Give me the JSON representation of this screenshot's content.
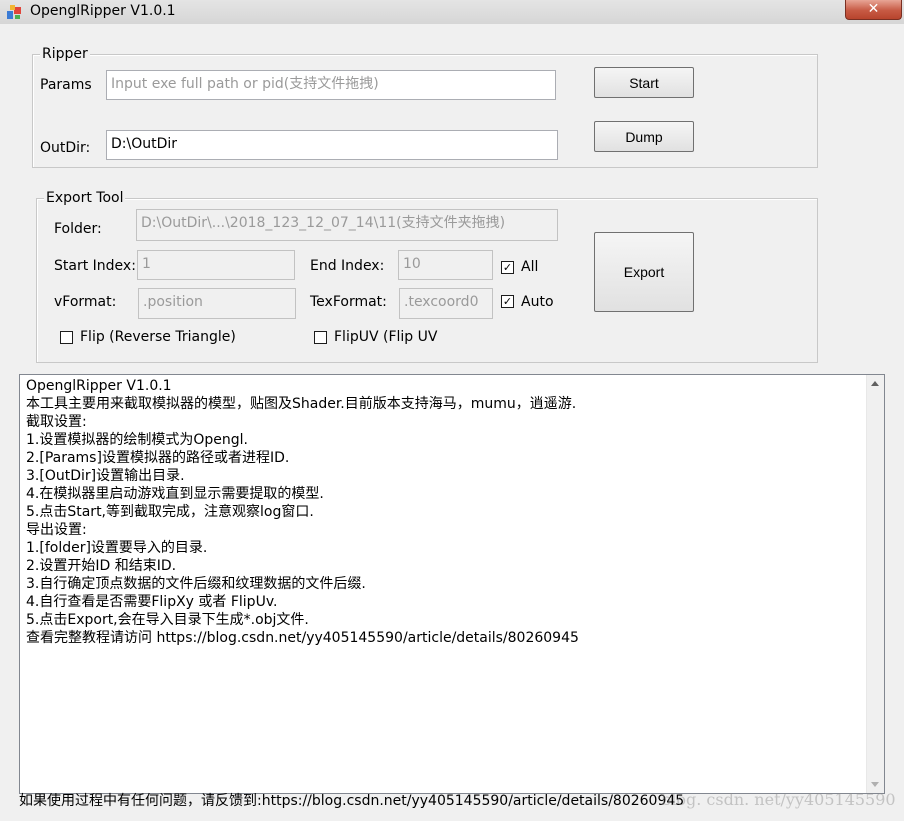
{
  "window": {
    "title": "OpenglRipper V1.0.1",
    "close_label": "✕"
  },
  "ripper": {
    "legend": "Ripper",
    "params_label": "Params",
    "params_placeholder": "Input exe full path or pid(支持文件拖拽)",
    "outdir_label": "OutDir:",
    "outdir_value": "D:\\OutDir",
    "start_label": "Start",
    "dump_label": "Dump"
  },
  "export": {
    "legend": "Export Tool",
    "folder_label": "Folder:",
    "folder_placeholder": "D:\\OutDir\\...\\2018_123_12_07_14\\11(支持文件夹拖拽)",
    "start_index_label": "Start Index:",
    "start_index_placeholder": "1",
    "end_index_label": "End Index:",
    "end_index_placeholder": "10",
    "all_label": "All",
    "all_checked": true,
    "vformat_label": "vFormat:",
    "vformat_placeholder": ".position",
    "texformat_label": "TexFormat:",
    "texformat_placeholder": ".texcoord0",
    "auto_label": "Auto",
    "auto_checked": true,
    "flip_label": "Flip (Reverse Triangle)",
    "flip_checked": false,
    "flipuv_label": "FlipUV (Flip UV",
    "flipuv_checked": false,
    "export_label": "Export"
  },
  "log": {
    "lines": [
      "OpenglRipper V1.0.1",
      "本工具主要用来截取模拟器的模型，贴图及Shader.目前版本支持海马，mumu，逍遥游.",
      "截取设置:",
      "1.设置模拟器的绘制模式为Opengl.",
      "2.[Params]设置模拟器的路径或者进程ID.",
      "3.[OutDir]设置输出目录.",
      "4.在模拟器里启动游戏直到显示需要提取的模型.",
      "5.点击Start,等到截取完成，注意观察log窗口.",
      "导出设置:",
      "1.[folder]设置要导入的目录.",
      "2.设置开始ID 和结束ID.",
      "3.自行确定顶点数据的文件后缀和纹理数据的文件后缀.",
      "4.自行查看是否需要FlipXy 或者 FlipUv.",
      "5.点击Export,会在导入目录下生成*.obj文件.",
      "查看完整教程请访问 https://blog.csdn.net/yy405145590/article/details/80260945"
    ]
  },
  "footer": {
    "text": "如果使用过程中有任何问题，请反馈到:https://blog.csdn.net/yy405145590/article/details/80260945",
    "watermark": "blog. csdn. net/yy405145590"
  },
  "icons": {
    "app": "app-icon",
    "check": "✓"
  }
}
